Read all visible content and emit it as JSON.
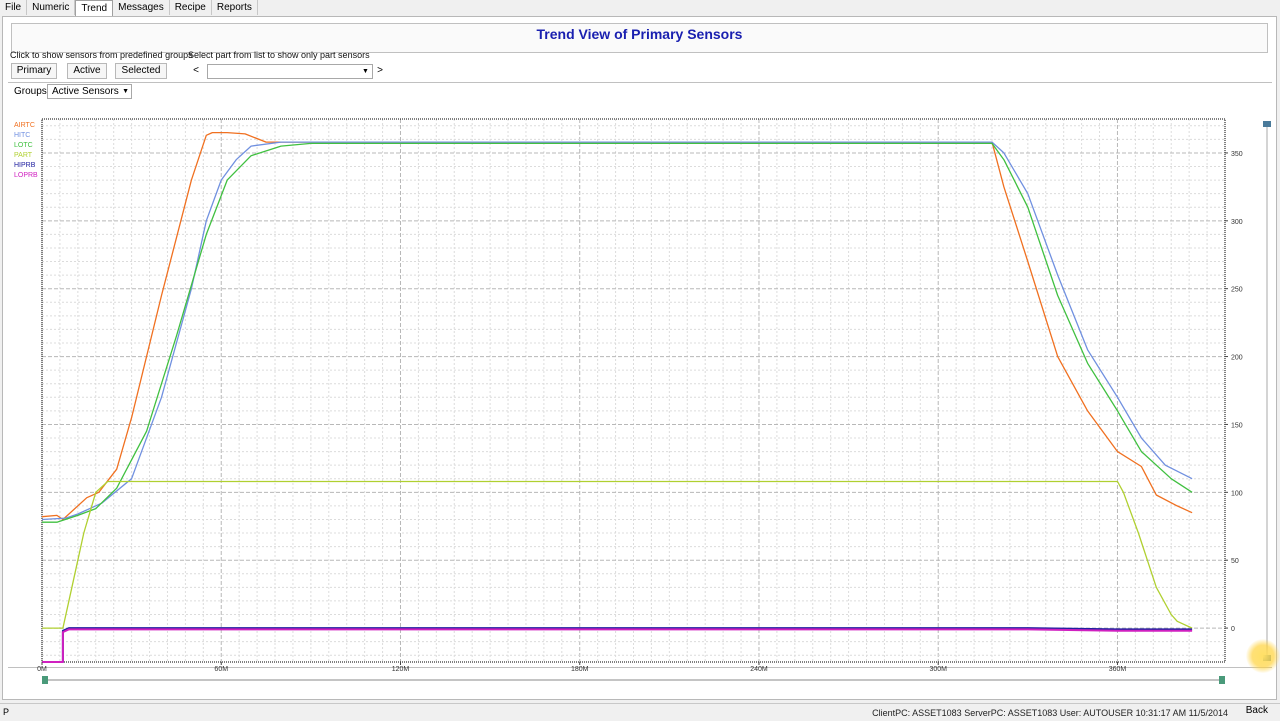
{
  "menu": {
    "items": [
      {
        "label": "File"
      },
      {
        "label": "Numeric"
      },
      {
        "label": "Trend",
        "active": true
      },
      {
        "label": "Messages"
      },
      {
        "label": "Recipe"
      },
      {
        "label": "Reports"
      }
    ]
  },
  "header": {
    "title": "Trend View of Primary Sensors"
  },
  "controls": {
    "groups_hint": "Click to show sensors from predefined groups",
    "part_hint": "Select part from list to show only part sensors",
    "primary_label": "Primary",
    "active_label": "Active",
    "selected_label": "Selected",
    "prev_label": "<",
    "next_label": ">",
    "part_value": "",
    "groups_label": "Groups",
    "groups_value": "Active Sensors"
  },
  "chart_data": {
    "type": "line",
    "xlabel": "",
    "ylabel": "",
    "xlim": [
      0,
      396
    ],
    "ylim": [
      -25,
      375
    ],
    "x_ticks": [
      0,
      60,
      120,
      180,
      240,
      300,
      360
    ],
    "x_tick_labels": [
      "0M",
      "60M",
      "120M",
      "180M",
      "240M",
      "300M",
      "360M"
    ],
    "y_ticks": [
      0,
      50,
      100,
      150,
      200,
      250,
      300,
      350
    ],
    "y_tick_labels": [
      "0",
      "50",
      "100",
      "150",
      "200",
      "250",
      "300",
      "350"
    ],
    "grid": true,
    "legend_position": "top-left",
    "series": [
      {
        "name": "AIRTC",
        "color": "#f07020",
        "x": [
          0,
          5,
          7,
          15,
          18,
          19,
          25,
          30,
          40,
          50,
          55,
          57,
          62,
          68,
          75,
          100,
          200,
          300,
          318,
          322,
          330,
          340,
          350,
          360,
          368,
          373,
          380,
          385
        ],
        "y": [
          82,
          83,
          80,
          96,
          99,
          100,
          117,
          155,
          245,
          330,
          363,
          365,
          365,
          364,
          358,
          358,
          358,
          358,
          358,
          325,
          270,
          200,
          160,
          130,
          119,
          98,
          90,
          85
        ]
      },
      {
        "name": "HITC",
        "color": "#7090e0",
        "x": [
          0,
          8,
          12,
          20,
          30,
          40,
          50,
          55,
          60,
          65,
          70,
          80,
          100,
          200,
          300,
          318,
          322,
          330,
          340,
          350,
          360,
          368,
          376,
          385
        ],
        "y": [
          80,
          81,
          84,
          92,
          110,
          170,
          250,
          300,
          330,
          345,
          355,
          358,
          358,
          358,
          358,
          358,
          350,
          320,
          260,
          205,
          170,
          140,
          120,
          110
        ]
      },
      {
        "name": "LOTC",
        "color": "#40c040",
        "x": [
          0,
          5,
          12,
          18,
          25,
          35,
          45,
          55,
          62,
          70,
          80,
          90,
          100,
          200,
          300,
          318,
          322,
          330,
          340,
          350,
          360,
          368,
          378,
          385
        ],
        "y": [
          78,
          78,
          83,
          88,
          103,
          145,
          215,
          290,
          330,
          348,
          355,
          357,
          357,
          357,
          357,
          357,
          345,
          310,
          245,
          195,
          160,
          130,
          110,
          100
        ]
      },
      {
        "name": "PART",
        "color": "#b0d030",
        "x": [
          0,
          4,
          7,
          10,
          14,
          18,
          22,
          40,
          100,
          200,
          300,
          355,
          360,
          362,
          367,
          373,
          378,
          380,
          385
        ],
        "y": [
          0,
          0,
          0,
          30,
          70,
          100,
          108,
          108,
          108,
          108,
          108,
          108,
          108,
          100,
          70,
          30,
          10,
          5,
          0
        ]
      },
      {
        "name": "HIPRB",
        "color": "#2020a0",
        "x": [
          0,
          7,
          7,
          9,
          12,
          20,
          50,
          100,
          200,
          300,
          330,
          360,
          385
        ],
        "y": [
          -25,
          -25,
          -2,
          0,
          0,
          0,
          0,
          0,
          0,
          0,
          0,
          -1,
          -1
        ]
      },
      {
        "name": "LOPRB",
        "color": "#d020c0",
        "x": [
          0,
          7,
          7,
          9,
          12,
          20,
          50,
          100,
          200,
          300,
          330,
          360,
          385
        ],
        "y": [
          -25,
          -25,
          -3,
          -1,
          -1,
          -1,
          -1,
          -1,
          -1,
          -1,
          -1,
          -2,
          -2
        ]
      }
    ]
  },
  "status": {
    "left": "P",
    "text": "ClientPC: ASSET1083  ServerPC: ASSET1083  User: AUTOUSER  10:31:17 AM 11/5/2014",
    "back_label": "Back"
  }
}
